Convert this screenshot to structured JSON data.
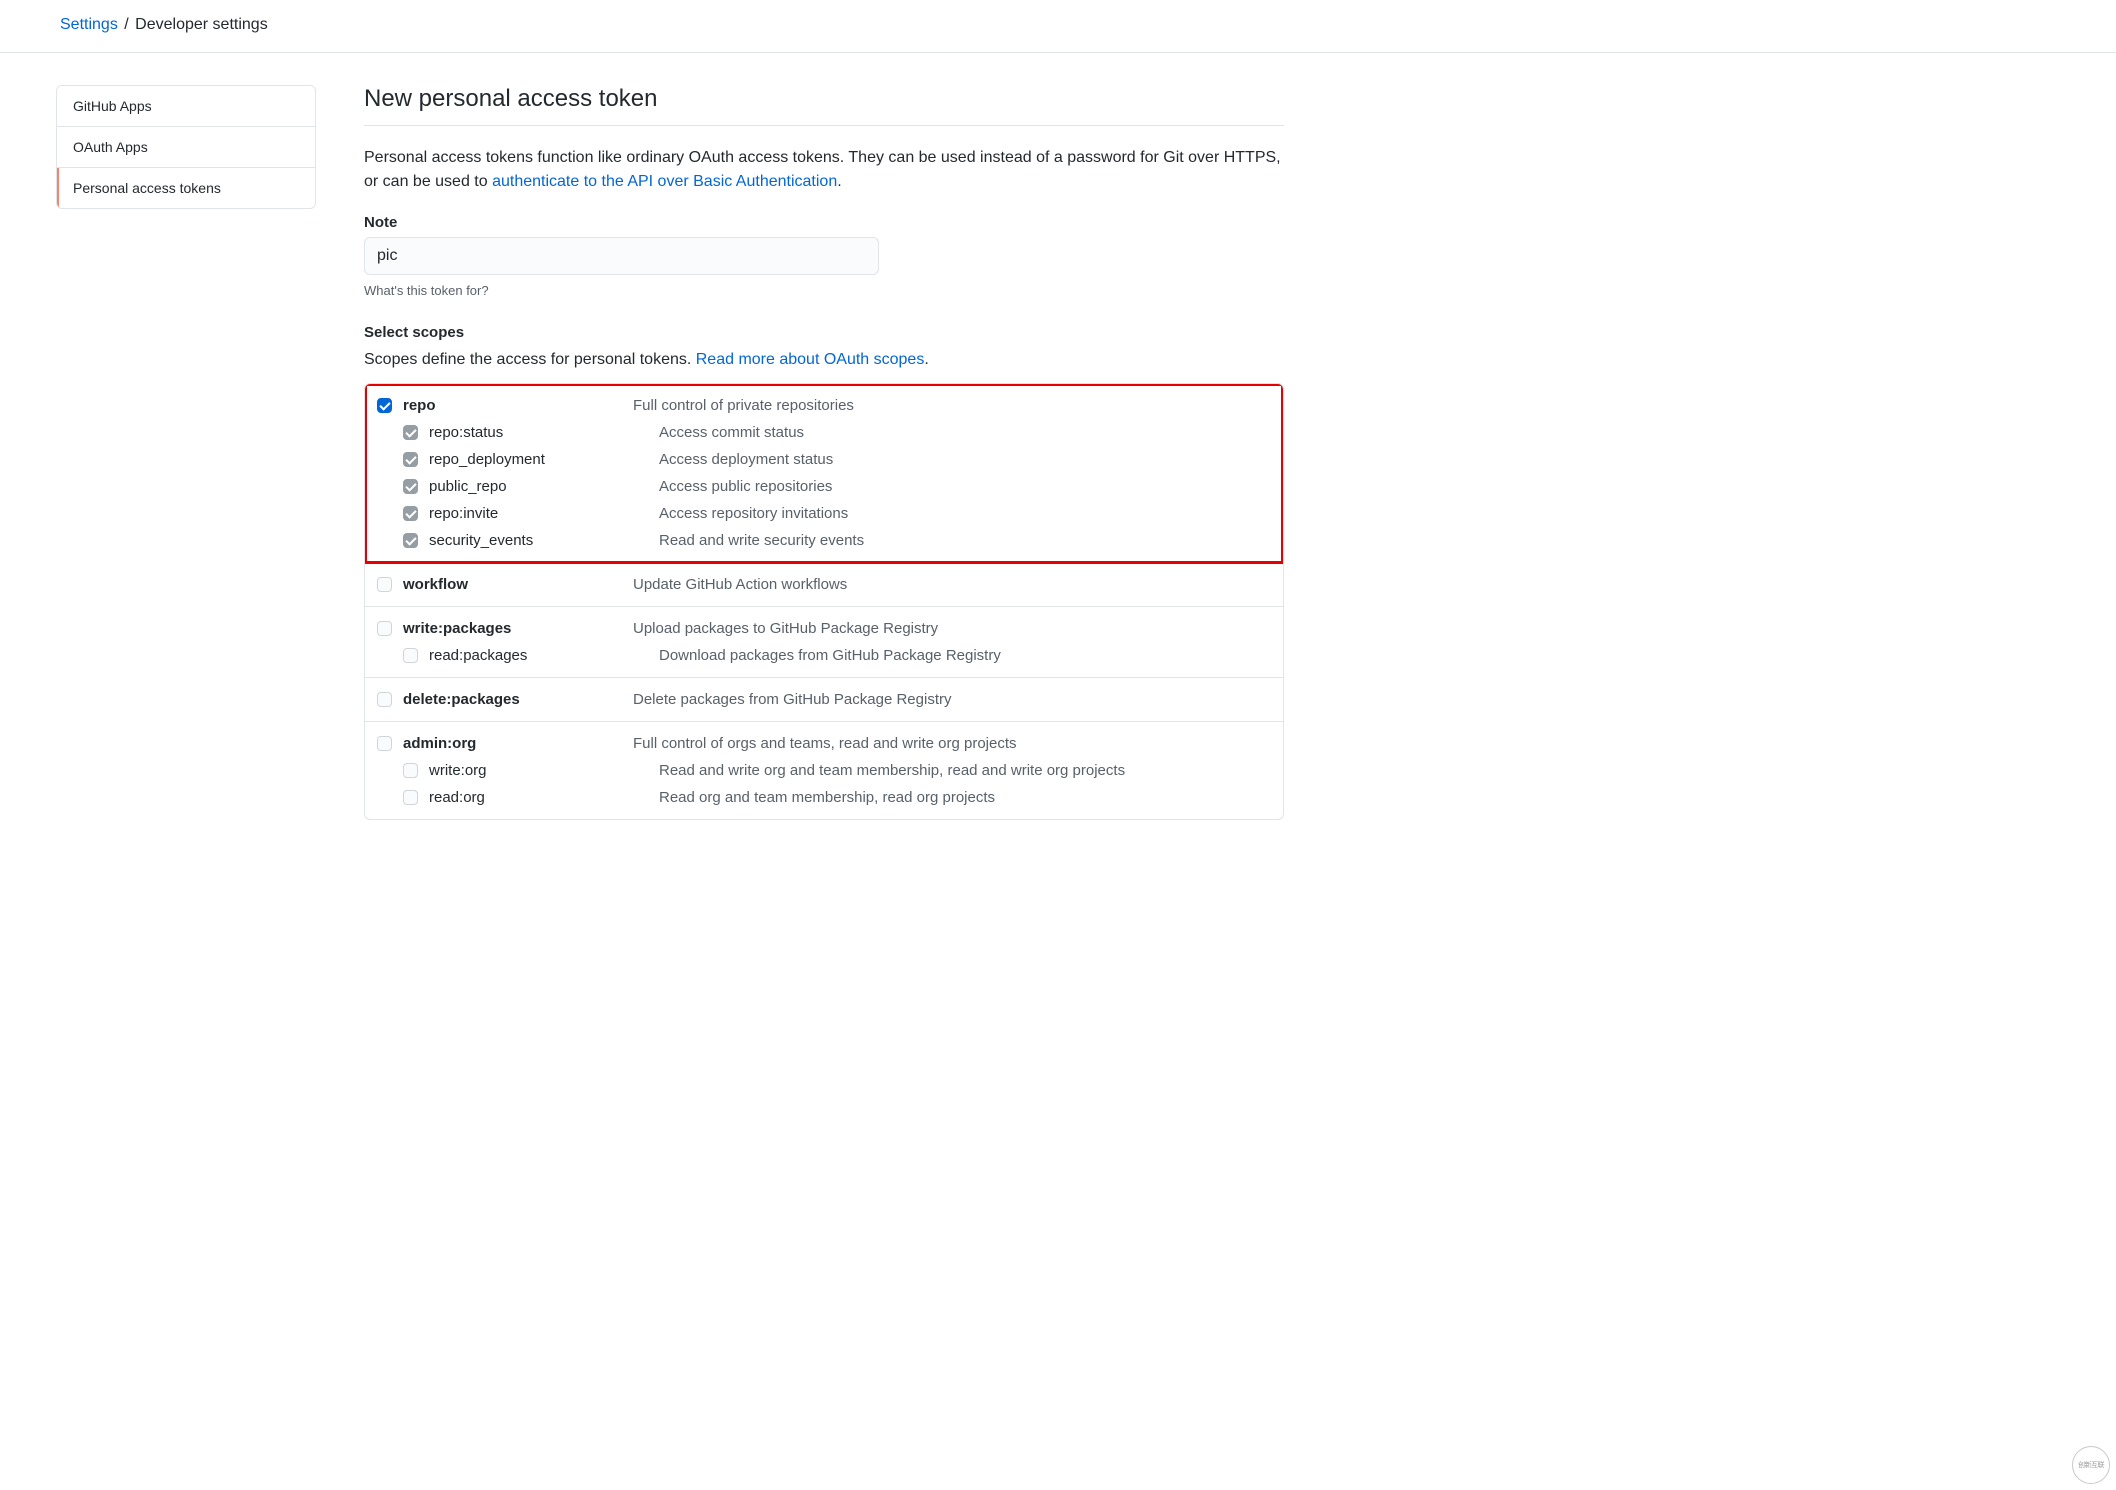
{
  "breadcrumb": {
    "root": "Settings",
    "separator": "/",
    "current": "Developer settings"
  },
  "sidebar": {
    "items": [
      {
        "label": "GitHub Apps",
        "active": false
      },
      {
        "label": "OAuth Apps",
        "active": false
      },
      {
        "label": "Personal access tokens",
        "active": true
      }
    ]
  },
  "page": {
    "title": "New personal access token",
    "intro_before": "Personal access tokens function like ordinary OAuth access tokens. They can be used instead of a password for Git over HTTPS, or can be used to ",
    "intro_link": "authenticate to the API over Basic Authentication",
    "intro_after": "."
  },
  "note_field": {
    "label": "Note",
    "value": "pic",
    "hint": "What's this token for?"
  },
  "scopes": {
    "heading": "Select scopes",
    "intro_before": "Scopes define the access for personal tokens. ",
    "intro_link": "Read more about OAuth scopes",
    "intro_after": "."
  },
  "scope_groups": [
    {
      "highlight": true,
      "parent": {
        "name": "repo",
        "desc": "Full control of private repositories",
        "checked": true,
        "disabled": false
      },
      "children": [
        {
          "name": "repo:status",
          "desc": "Access commit status",
          "checked": true,
          "disabled": true
        },
        {
          "name": "repo_deployment",
          "desc": "Access deployment status",
          "checked": true,
          "disabled": true
        },
        {
          "name": "public_repo",
          "desc": "Access public repositories",
          "checked": true,
          "disabled": true
        },
        {
          "name": "repo:invite",
          "desc": "Access repository invitations",
          "checked": true,
          "disabled": true
        },
        {
          "name": "security_events",
          "desc": "Read and write security events",
          "checked": true,
          "disabled": true
        }
      ]
    },
    {
      "highlight": false,
      "parent": {
        "name": "workflow",
        "desc": "Update GitHub Action workflows",
        "checked": false,
        "disabled": false
      },
      "children": []
    },
    {
      "highlight": false,
      "parent": {
        "name": "write:packages",
        "desc": "Upload packages to GitHub Package Registry",
        "checked": false,
        "disabled": false
      },
      "children": [
        {
          "name": "read:packages",
          "desc": "Download packages from GitHub Package Registry",
          "checked": false,
          "disabled": false
        }
      ]
    },
    {
      "highlight": false,
      "parent": {
        "name": "delete:packages",
        "desc": "Delete packages from GitHub Package Registry",
        "checked": false,
        "disabled": false
      },
      "children": []
    },
    {
      "highlight": false,
      "parent": {
        "name": "admin:org",
        "desc": "Full control of orgs and teams, read and write org projects",
        "checked": false,
        "disabled": false
      },
      "children": [
        {
          "name": "write:org",
          "desc": "Read and write org and team membership, read and write org projects",
          "checked": false,
          "disabled": false
        },
        {
          "name": "read:org",
          "desc": "Read org and team membership, read org projects",
          "checked": false,
          "disabled": false
        }
      ]
    }
  ],
  "watermark": "创新互联"
}
